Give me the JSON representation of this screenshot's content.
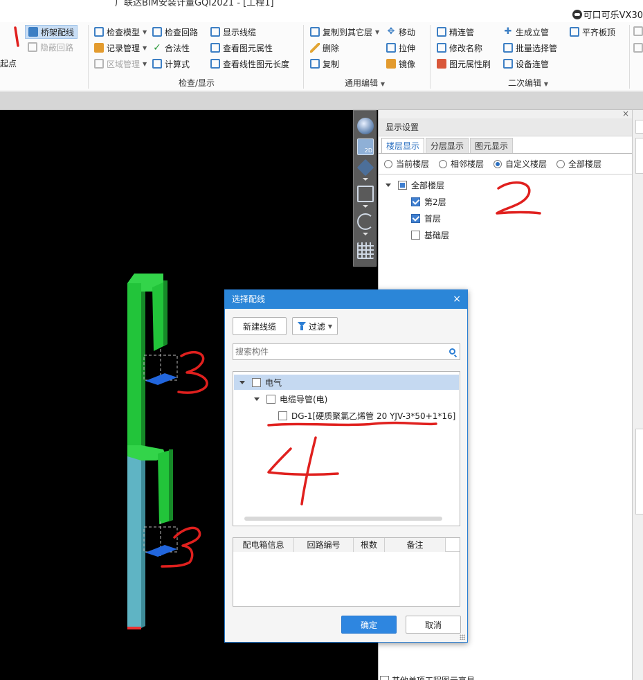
{
  "titlebar": {
    "doc_title": "广联达BIM安装计量GQI2021 - [工程1]",
    "user": "可口可乐VX30"
  },
  "ribbon": {
    "left_partial": "起点",
    "group_left": {
      "bridge_wiring": "桥架配线",
      "hidden_loop": "隐蔽回路"
    },
    "group_check": {
      "label": "检查/显示",
      "check_model": "检查模型",
      "record_manage": "记录管理",
      "area_manage": "区域管理",
      "check_loop": "检查回路",
      "legality": "合法性",
      "calculator": "计算式",
      "show_cable": "显示线缆",
      "view_attr": "查看图元属性",
      "view_length": "查看线性图元长度"
    },
    "group_edit": {
      "label": "通用编辑",
      "copy_to_floor": "复制到其它层",
      "move": "移动",
      "delete": "删除",
      "stretch": "拉伸",
      "copy": "复制",
      "mirror": "镜像"
    },
    "group_secondary": {
      "label": "二次编辑",
      "connect_pipe": "精连管",
      "rename": "修改名称",
      "attr_brush": "图元属性刷",
      "gen_riser": "生成立管",
      "batch_select": "批量选择管",
      "device_pipe": "设备连管",
      "flush_top": "平齐板顶"
    }
  },
  "display_settings": {
    "title": "显示设置",
    "tabs": [
      "楼层显示",
      "分层显示",
      "图元显示"
    ],
    "radios": [
      "当前楼层",
      "相邻楼层",
      "自定义楼层",
      "全部楼层"
    ],
    "selected_radio": "自定义楼层",
    "tree": {
      "root": "全部楼层",
      "floors": [
        {
          "label": "第2层",
          "checked": true
        },
        {
          "label": "首层",
          "checked": true
        },
        {
          "label": "基础层",
          "checked": false
        }
      ]
    },
    "bottom_option": "其他单项工程图元亮显"
  },
  "viewport": {
    "toolbar_2d_label": "2D"
  },
  "dialog": {
    "title": "选择配线",
    "new_cable_button": "新建线缆",
    "filter_button": "过滤",
    "search_placeholder": "搜索构件",
    "tree": {
      "root": "电气",
      "child": "电缆导管(电)",
      "leaf": "DG-1[硬质聚氯乙烯管 20 YJV-3*50+1*16]"
    },
    "table_columns": [
      "配电箱信息",
      "回路编号",
      "根数",
      "备注"
    ],
    "ok_button": "确定",
    "cancel_button": "取消"
  },
  "annotations": [
    "1",
    "2",
    "3",
    "3",
    "4"
  ],
  "colors": {
    "accent": "#2b86d8",
    "pipe_upper": "#22c43a",
    "pipe_lower": "#5fb4c4",
    "annotation": "#e0201e",
    "viewport_bg": "#000000"
  }
}
